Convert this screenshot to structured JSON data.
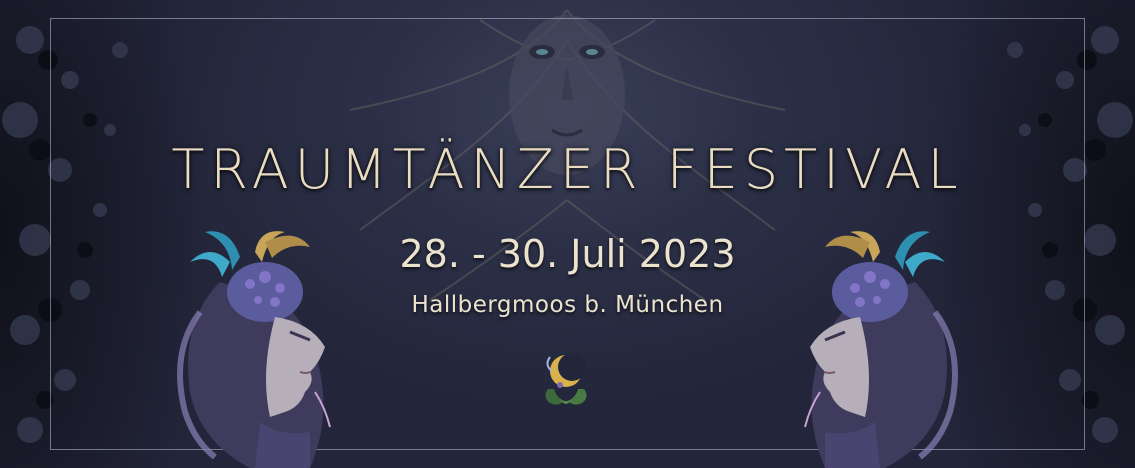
{
  "banner": {
    "title": "TRAUMTÄNZER FESTIVAL",
    "date": "28. - 30. Juli 2023",
    "location": "Hallbergmoos b. München"
  },
  "colors": {
    "background": "#23263a",
    "text_gold": "#e9dcc0",
    "frame": "#bec3d7",
    "horn_gold": "#c9a55a",
    "feather_blue": "#3fa9c9"
  },
  "icons": {
    "center_emblem": "crescent-moon-emblem-icon",
    "left_figure": "horned-faun-woman-illustration",
    "right_figure": "horned-faun-woman-illustration",
    "background_art": "sun-face-illustration"
  }
}
